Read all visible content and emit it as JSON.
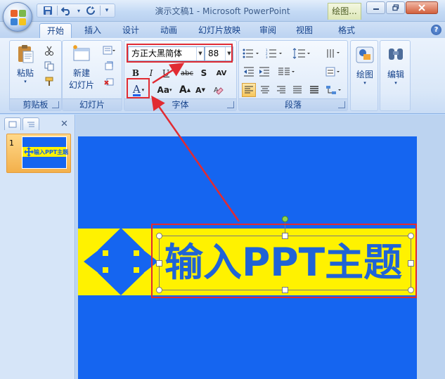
{
  "window": {
    "title": "演示文稿1 - Microsoft PowerPoint",
    "context_tab_title": "绘图...",
    "controls": [
      "minimize-icon",
      "restore-icon",
      "close-icon"
    ]
  },
  "quick_access": [
    "save-icon",
    "undo-icon",
    "redo-icon",
    "customize-icon"
  ],
  "tabs": [
    {
      "label": "开始",
      "active": true
    },
    {
      "label": "插入"
    },
    {
      "label": "设计"
    },
    {
      "label": "动画"
    },
    {
      "label": "幻灯片放映"
    },
    {
      "label": "审阅"
    },
    {
      "label": "视图"
    },
    {
      "label": "格式"
    }
  ],
  "groups": {
    "clipboard": {
      "label": "剪贴板",
      "paste_label": "粘贴"
    },
    "slides": {
      "label": "幻灯片",
      "new_slide_line1": "新建",
      "new_slide_line2": "幻灯片"
    },
    "font": {
      "label": "字体",
      "font_name": "方正大黑简体",
      "font_size": "88",
      "bold": "B",
      "italic": "I",
      "underline": "U",
      "strike": "abc",
      "shadow": "S",
      "spacing": "AV",
      "font_color": "A",
      "change_case": "Aa",
      "grow": "A",
      "shrink": "A"
    },
    "paragraph": {
      "label": "段落"
    },
    "drawing": {
      "label": "绘图"
    },
    "editing": {
      "label": "编辑"
    }
  },
  "slides_panel": {
    "slide_number": "1",
    "thumb_text": "输入PPT主题"
  },
  "slide": {
    "title": "输入PPT主题"
  },
  "colors": {
    "slide_blue": "#1565f0",
    "band_yellow": "#fff200",
    "title_blue": "#1f63d6",
    "annotation_red": "#e12b32"
  }
}
